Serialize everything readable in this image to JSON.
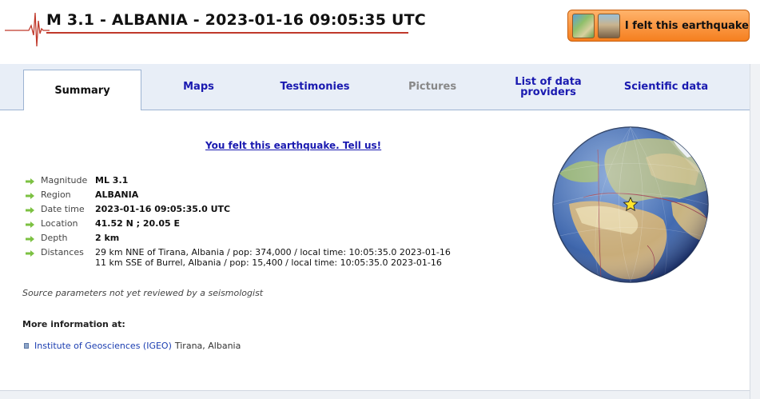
{
  "header": {
    "title": "M 3.1 - ALBANIA - 2023-01-16 09:05:35 UTC",
    "felt_button_label": "I felt this earthquake"
  },
  "tabs": [
    {
      "label": "Summary",
      "state": "active"
    },
    {
      "label": "Maps",
      "state": "normal"
    },
    {
      "label": "Testimonies",
      "state": "normal"
    },
    {
      "label": "Pictures",
      "state": "disabled"
    },
    {
      "label": "List of data providers",
      "state": "normal"
    },
    {
      "label": "Scientific data",
      "state": "normal"
    }
  ],
  "tell_link": "You felt this earthquake. Tell us!",
  "params": {
    "magnitude": {
      "label": "Magnitude",
      "value": "ML 3.1"
    },
    "region": {
      "label": "Region",
      "value": "ALBANIA"
    },
    "datetime": {
      "label": "Date time",
      "value": "2023-01-16 09:05:35.0 UTC"
    },
    "location": {
      "label": "Location",
      "value": "41.52 N ; 20.05 E"
    },
    "depth": {
      "label": "Depth",
      "value": "2 km"
    },
    "distances": {
      "label": "Distances",
      "lines": [
        "29 km NNE of Tirana, Albania / pop: 374,000 / local time: 10:05:35.0 2023-01-16",
        "11 km SSE of Burrel, Albania / pop: 15,400 / local time: 10:05:35.0 2023-01-16"
      ]
    }
  },
  "source_note": "Source parameters not yet reviewed by a seismologist",
  "more_info": {
    "heading": "More information at:",
    "provider_name": "Institute of Geosciences (IGEO)",
    "provider_location": "Tirana, Albania"
  },
  "colors": {
    "link": "#1a1ab0",
    "tab_bar": "#e8eef7",
    "felt_button": "#f57f1f",
    "title_underline": "#c0392b"
  },
  "icons": {
    "seismogram": "seismogram-logo-icon",
    "arrow": "green-arrow-icon",
    "epicenter": "yellow-star-icon"
  }
}
